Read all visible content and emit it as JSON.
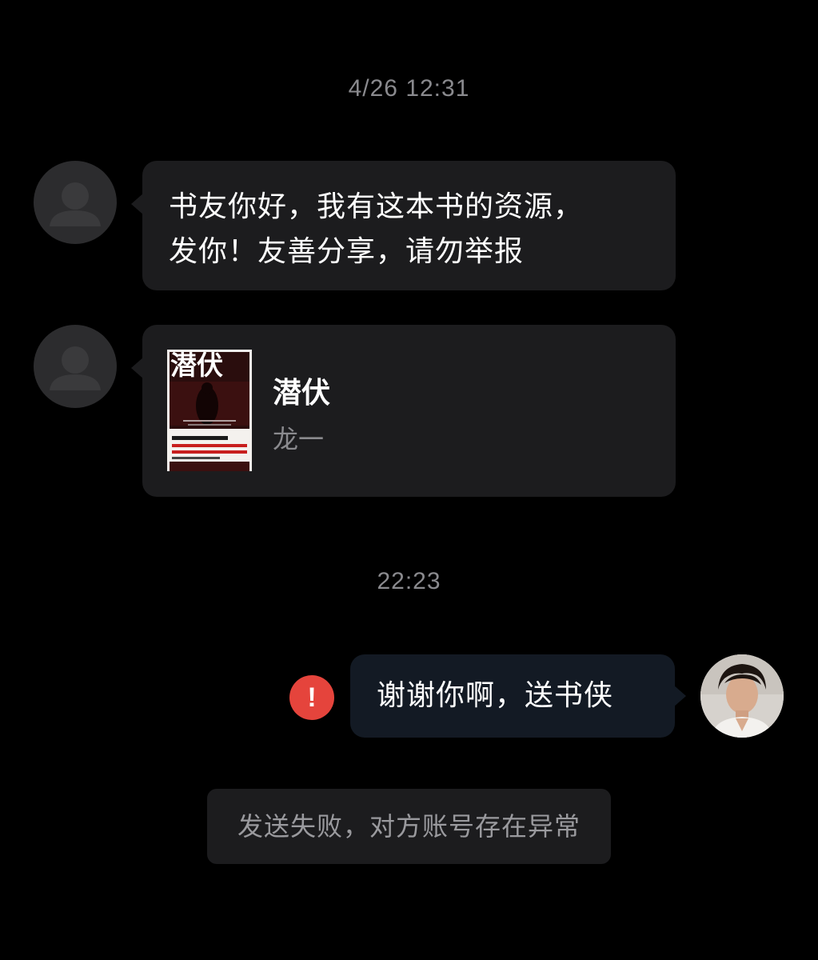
{
  "chat": {
    "timestamps": [
      "4/26 12:31",
      "22:23"
    ],
    "messages": [
      {
        "sender": "other",
        "type": "text",
        "lines": [
          "书友你好，我有这本书的资源，",
          "发你！友善分享，请勿举报"
        ]
      },
      {
        "sender": "other",
        "type": "book_card",
        "book": {
          "title": "潜伏",
          "author": "龙一",
          "cover_title": "潜伏"
        }
      },
      {
        "sender": "self",
        "type": "text",
        "text": "谢谢你啊，送书侠",
        "status": "failed",
        "status_icon": "exclamation-icon"
      }
    ],
    "system_notice": "发送失败，对方账号存在异常"
  },
  "colors": {
    "background": "#000000",
    "bubble_other": "#1c1c1e",
    "bubble_self": "#131a24",
    "timestamp": "#8a8a8e",
    "error": "#e5443c"
  }
}
